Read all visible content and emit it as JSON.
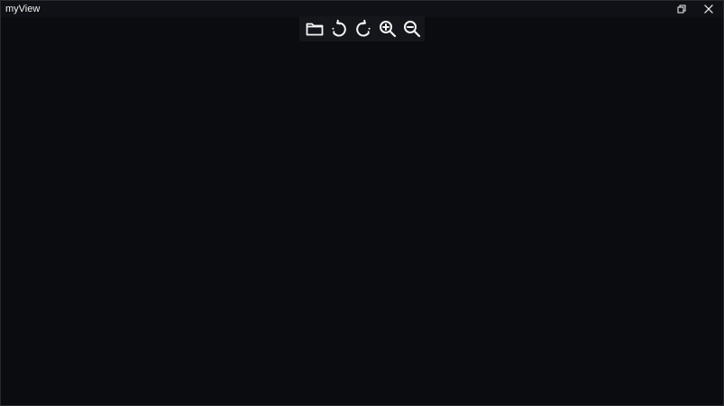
{
  "window": {
    "title": "myView"
  },
  "toolbar": {
    "buttons": [
      {
        "icon": "folder-open-icon"
      },
      {
        "icon": "rotate-left-icon"
      },
      {
        "icon": "rotate-right-icon"
      },
      {
        "icon": "zoom-in-icon"
      },
      {
        "icon": "zoom-out-icon"
      }
    ]
  },
  "window_controls": {
    "restore_icon": "restore-icon",
    "close_icon": "close-icon"
  },
  "colors": {
    "background": "#0b0c10",
    "titlebar": "#101116",
    "toolbar": "#15161b",
    "icon": "#f5f5f5"
  }
}
